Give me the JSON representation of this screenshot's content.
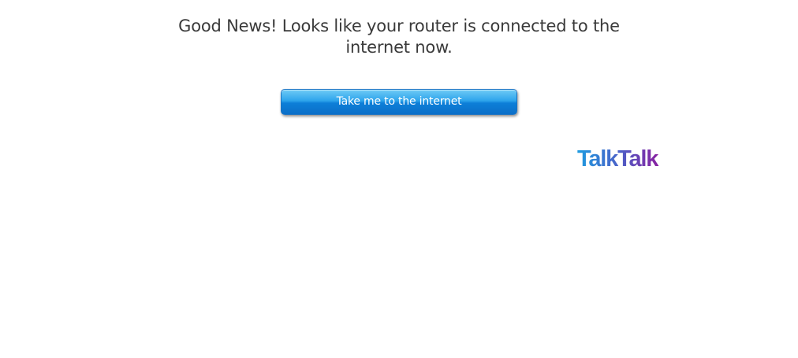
{
  "message": {
    "line1": "Good News! Looks like your router is connected to the",
    "line2": "internet now."
  },
  "button": {
    "label": "Take me to the internet"
  },
  "logo": {
    "text": "TalkTalk",
    "colors": {
      "start": "#1e9be0",
      "mid": "#4a62c8",
      "end": "#8a1fa0"
    }
  },
  "colors": {
    "text": "#3a3a3a",
    "button_top": "#6fcbf6",
    "button_bottom": "#0b6fc8",
    "background": "#ffffff"
  }
}
